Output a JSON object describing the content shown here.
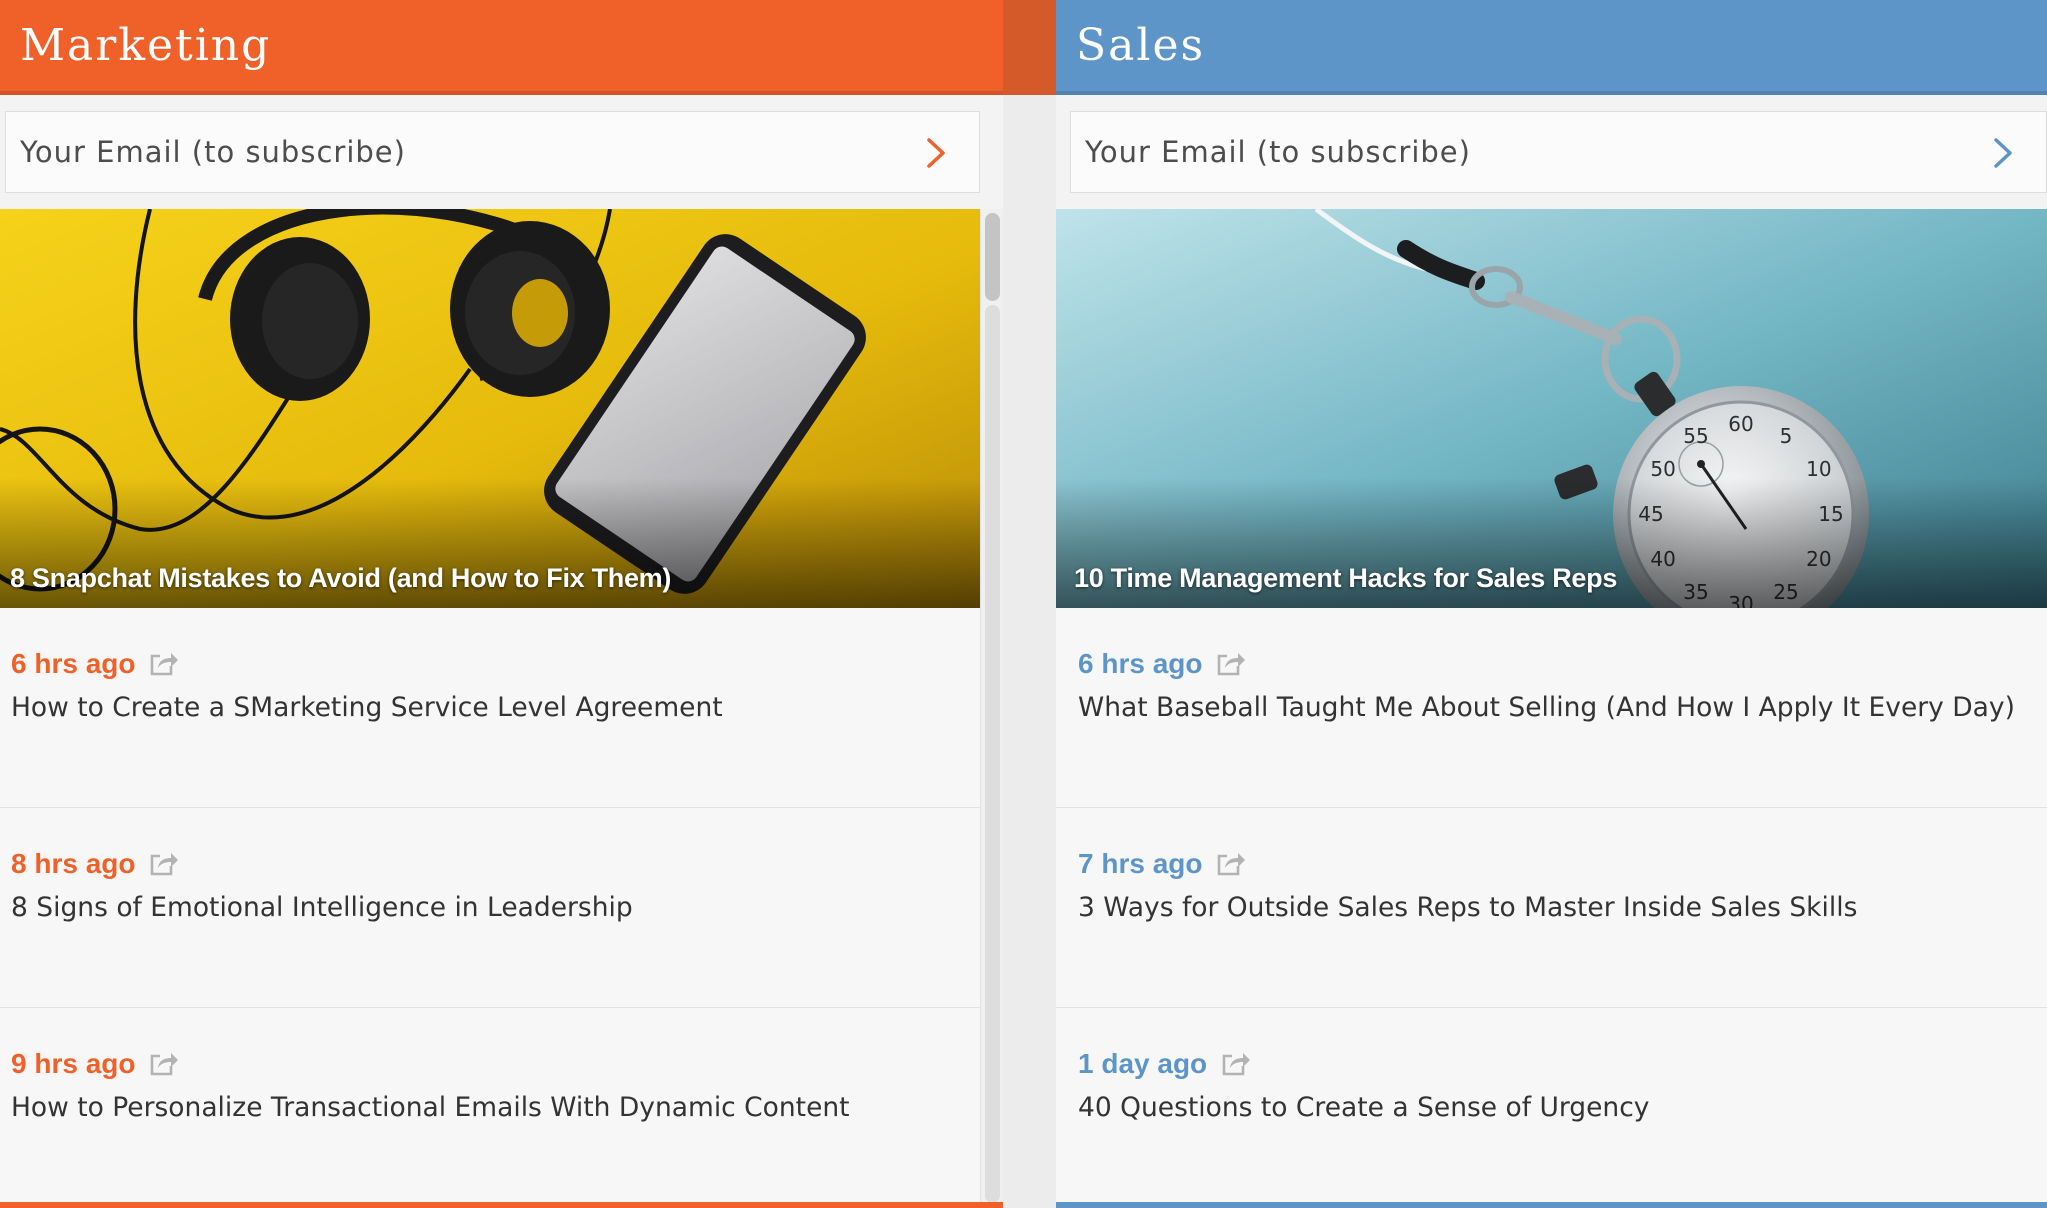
{
  "colors": {
    "marketing": "#f06029",
    "sales": "#5e95c8"
  },
  "marketing": {
    "title": "Marketing",
    "subscribe_placeholder": "Your Email (to subscribe)",
    "featured_title": "8 Snapchat Mistakes to Avoid (and How to Fix Them)",
    "items": [
      {
        "time": "6 hrs ago",
        "title": "How to Create a SMarketing Service Level Agreement"
      },
      {
        "time": "8 hrs ago",
        "title": "8 Signs of Emotional Intelligence in Leadership"
      },
      {
        "time": "9 hrs ago",
        "title": "How to Personalize Transactional Emails With Dynamic Content"
      }
    ]
  },
  "sales": {
    "title": "Sales",
    "subscribe_placeholder": "Your Email (to subscribe)",
    "featured_title": "10 Time Management Hacks for Sales Reps",
    "items": [
      {
        "time": "6 hrs ago",
        "title": "What Baseball Taught Me About Selling (And How I Apply It Every Day)"
      },
      {
        "time": "7 hrs ago",
        "title": "3 Ways for Outside Sales Reps to Master Inside Sales Skills"
      },
      {
        "time": "1 day ago",
        "title": "40 Questions to Create a Sense of Urgency"
      }
    ]
  },
  "stopwatch_numbers": [
    "60",
    "5",
    "10",
    "15",
    "20",
    "25",
    "30",
    "35",
    "40",
    "45",
    "50",
    "55"
  ],
  "icons": {
    "subscribe": "chevron-right-icon",
    "share": "share-icon"
  }
}
